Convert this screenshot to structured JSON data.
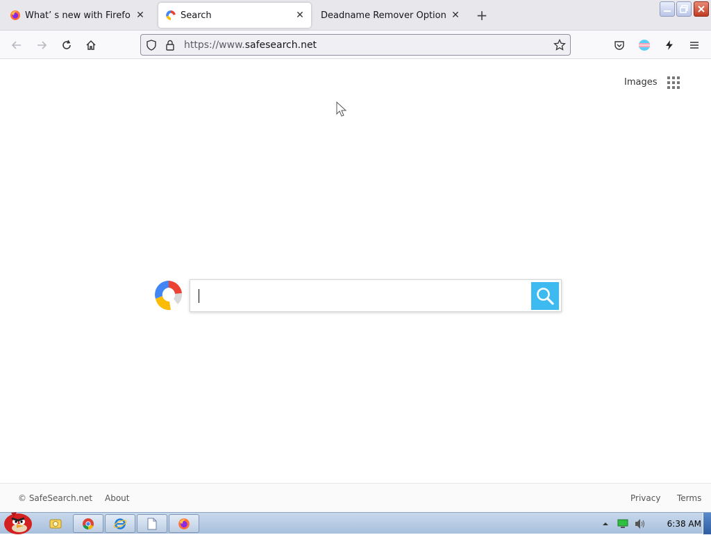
{
  "browser": {
    "tabs": [
      {
        "title": "What’ s new with Firefox - M",
        "icon": "firefox-icon",
        "active": false
      },
      {
        "title": "Search",
        "icon": "safesearch-icon",
        "active": true
      },
      {
        "title": "Deadname Remover Options",
        "icon": "",
        "active": false
      }
    ],
    "tab_close_glyph": "✕",
    "new_tab_glyph": "+",
    "url_prefix": "https://www.",
    "url_domain": "safesearch.net"
  },
  "page": {
    "images_link": "Images",
    "search_placeholder": "",
    "search_value": "",
    "footer": {
      "copyright": "© SafeSearch.net",
      "about": "About",
      "privacy": "Privacy",
      "terms": "Terms"
    }
  },
  "taskbar": {
    "clock": "6:38 AM",
    "apps": [
      "explorer-icon",
      "chrome-icon",
      "internet-explorer-icon",
      "document-icon",
      "firefox-icon"
    ]
  },
  "colors": {
    "search_button": "#3dbbf0",
    "tabstrip": "#e8e8ec",
    "taskbar": "#b8cce4"
  }
}
